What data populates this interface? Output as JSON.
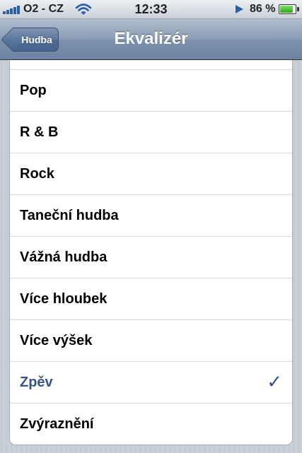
{
  "status_bar": {
    "carrier": "O2 - CZ",
    "time": "12:33",
    "battery_percent": "86 %",
    "battery_level": 0.86,
    "signal_icon": "signal-bars-icon",
    "wifi_icon": "wifi-icon",
    "play_icon": "play-icon"
  },
  "nav": {
    "back_label": "Hudba",
    "title": "Ekvalizér"
  },
  "list": {
    "items": [
      {
        "label": ""
      },
      {
        "label": "Pop"
      },
      {
        "label": "R & B"
      },
      {
        "label": "Rock"
      },
      {
        "label": "Taneční hudba"
      },
      {
        "label": "Vážná hudba"
      },
      {
        "label": "Více hloubek"
      },
      {
        "label": "Více výšek"
      },
      {
        "label": "Zpěv",
        "selected": true,
        "check": "✓"
      },
      {
        "label": "Zvýraznění"
      }
    ]
  },
  "colors": {
    "selected_text": "#385487",
    "nav_bar": "#6d83a1",
    "background": "#c5ccd4"
  }
}
